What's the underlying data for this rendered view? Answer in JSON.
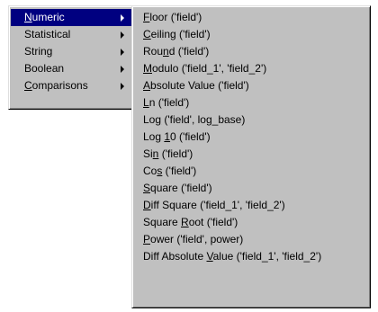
{
  "main_menu": {
    "items": [
      {
        "pre": "",
        "key": "N",
        "post": "umeric",
        "selected": true,
        "arrow_icon": "submenu-arrow-icon"
      },
      {
        "pre": "Statistical",
        "key": "",
        "post": "",
        "selected": false,
        "arrow_icon": "submenu-arrow-icon"
      },
      {
        "pre": "String",
        "key": "",
        "post": "",
        "selected": false,
        "arrow_icon": "submenu-arrow-icon"
      },
      {
        "pre": "Boolean",
        "key": "",
        "post": "",
        "selected": false,
        "arrow_icon": "submenu-arrow-icon"
      },
      {
        "pre": "",
        "key": "C",
        "post": "omparisons",
        "selected": false,
        "arrow_icon": "submenu-arrow-icon"
      }
    ]
  },
  "sub_menu": {
    "items": [
      {
        "pre": "",
        "key": "F",
        "post": "loor ('field')"
      },
      {
        "pre": "",
        "key": "C",
        "post": "eiling ('field')"
      },
      {
        "pre": "Rou",
        "key": "n",
        "post": "d ('field')"
      },
      {
        "pre": "",
        "key": "M",
        "post": "odulo ('field_1', 'field_2')"
      },
      {
        "pre": "",
        "key": "A",
        "post": "bsolute Value ('field')"
      },
      {
        "pre": "",
        "key": "L",
        "post": "n ('field')"
      },
      {
        "pre": "Lo",
        "key": "g",
        "post": " ('field', log_base)"
      },
      {
        "pre": "Log ",
        "key": "1",
        "post": "0 ('field')"
      },
      {
        "pre": "Si",
        "key": "n",
        "post": " ('field')"
      },
      {
        "pre": "Co",
        "key": "s",
        "post": " ('field')"
      },
      {
        "pre": "",
        "key": "S",
        "post": "quare ('field')"
      },
      {
        "pre": "",
        "key": "D",
        "post": "iff Square ('field_1', 'field_2')"
      },
      {
        "pre": "Square ",
        "key": "R",
        "post": "oot ('field')"
      },
      {
        "pre": "",
        "key": "P",
        "post": "ower ('field', power)"
      },
      {
        "pre": "Diff Absolute ",
        "key": "V",
        "post": "alue ('field_1', 'field_2')"
      }
    ]
  }
}
